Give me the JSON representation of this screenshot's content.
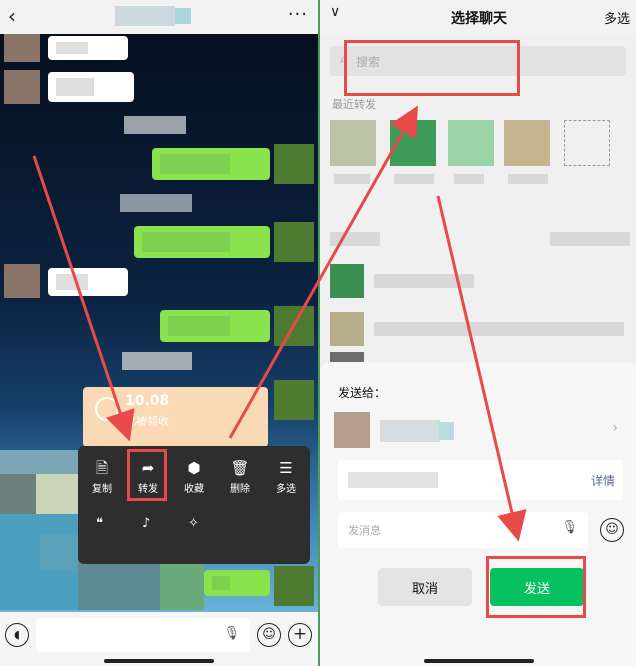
{
  "left": {
    "back_icon": "chevron-left-icon",
    "more_label": "···",
    "money": {
      "amount": "10.08",
      "status": "已被领收"
    },
    "menu": {
      "items": [
        {
          "icon": "copy-icon",
          "glyph": "🗎",
          "label": "复制"
        },
        {
          "icon": "forward-icon",
          "glyph": "➦",
          "label": "转发"
        },
        {
          "icon": "favorite-icon",
          "glyph": "⬢",
          "label": "收藏"
        },
        {
          "icon": "delete-icon",
          "glyph": "🗑",
          "label": "删除"
        },
        {
          "icon": "multiselect-icon",
          "glyph": "☰",
          "label": "多选"
        }
      ],
      "second_row_icons": [
        "quote-icon",
        "remind-icon",
        "search-icon"
      ],
      "second_row_glyphs": [
        "❝",
        "♪",
        "✧"
      ]
    },
    "bottom": {
      "voice_glyph": "◖",
      "mic_glyph": "🎙",
      "emoji_glyph": "☺",
      "plus_glyph": "+"
    }
  },
  "right": {
    "collapse_glyph": "∨",
    "title": "选择聊天",
    "multi_select": "多选",
    "search_placeholder": "搜索",
    "search_glyph": "⌕",
    "recent_label": "最近转发",
    "sheet": {
      "send_to_label": "发送给：",
      "arrow_glyph": "›",
      "detail_label": "详情",
      "message_placeholder": "发消息",
      "mic_glyph": "🎙",
      "emoji_glyph": "☺",
      "cancel_label": "取消",
      "send_label": "发送"
    }
  },
  "colors": {
    "accent_green": "#07c160",
    "highlight_red": "#e84a4a",
    "bubble_green": "#89e34d"
  }
}
